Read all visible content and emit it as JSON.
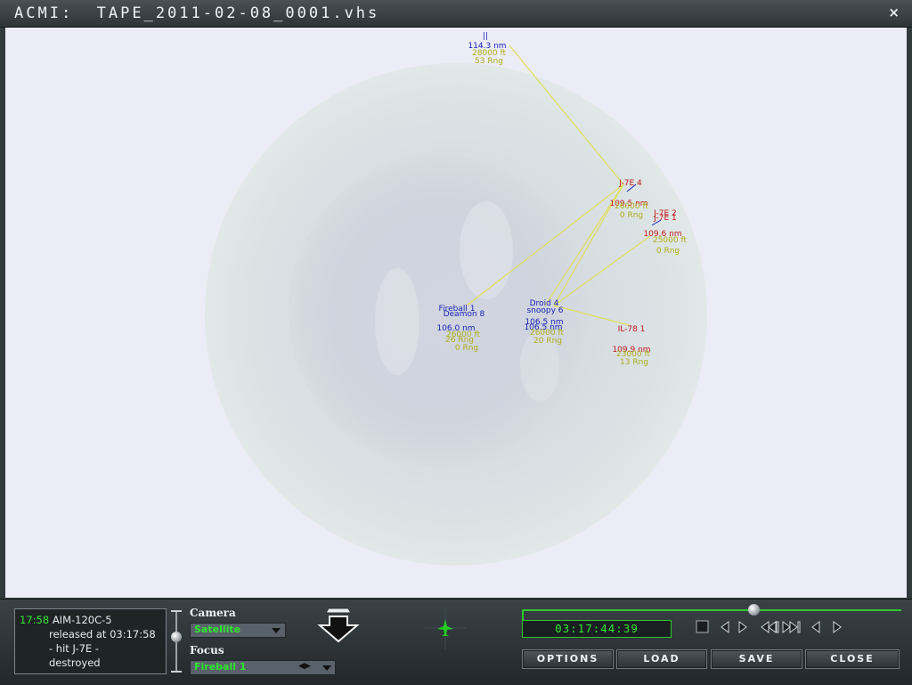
{
  "window": {
    "title": "ACMI:  TAPE_2011-02-08_0001.vhs",
    "close_glyph": "×"
  },
  "tactical_view": {
    "lines": {
      "top_a": "||",
      "top_b": "114.3 nm",
      "top_c": "28000 ft",
      "top_d": "53 Rng",
      "j7_a": "J-7E 4",
      "j7_b": "109.5 nm",
      "j7_c": "26000 ft",
      "j7_d": "0 Rng",
      "j7e2": "J-7E 2",
      "j7e1": "J-7E 1",
      "j7e1_b": "109.6 nm",
      "j7e1_c": "25000 ft",
      "j7e1_d": "0 Rng",
      "fireball_a": "Fireball 1",
      "fireball_b": "Deamon 8",
      "fireball_c": "106.0 nm",
      "fireball_d": "26000 ft",
      "fireball_e": "26 Rng",
      "fireball_f": "0 Rng",
      "droid_a": "Droid 4",
      "droid_b": "snoopy 6",
      "droid_c": "106.5 nm",
      "droid_d": "106.5 nm",
      "droid_e": "26000 ft",
      "droid_f": "20 Rng",
      "il78_a": "IL-78 1",
      "il78_b": "109.9 nm",
      "il78_c": "23000 ft",
      "il78_d": "13 Rng"
    }
  },
  "event_log": {
    "time": "17:58",
    "line1": "AIM-120C-5",
    "line2": "released at 03:17:58",
    "line3": "- hit J-7E -",
    "line4": "destroyed"
  },
  "camera": {
    "label": "Camera",
    "value": "Satellite"
  },
  "focus": {
    "label": "Focus",
    "value": "Fireball 1"
  },
  "playback": {
    "time": "03:17:44:39",
    "position": 0.61
  },
  "buttons": {
    "options": "OPTIONS",
    "load": "LOAD",
    "save": "SAVE",
    "close": "CLOSE"
  },
  "colors": {
    "friendly": "#1a22b8",
    "hostile": "#c0181b",
    "info": "#aeae18",
    "hud_green": "#2fe82f"
  }
}
